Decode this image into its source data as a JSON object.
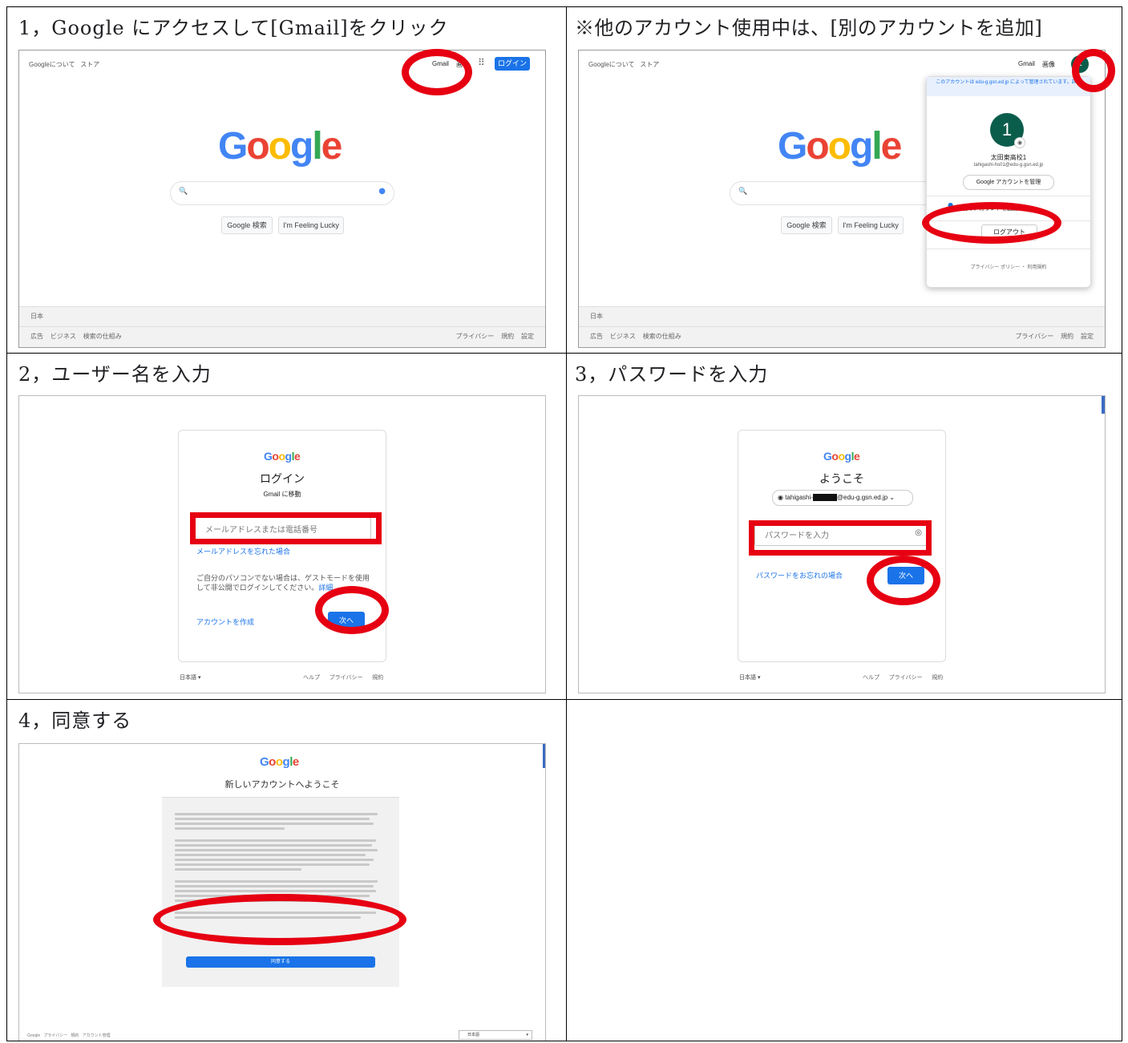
{
  "steps": {
    "s1": {
      "caption": "1，Google にアクセスして[Gmail]をクリック",
      "top_left": [
        "Googleについて",
        "ストア"
      ],
      "gmail": "Gmail",
      "images": "画",
      "login": "ログイン",
      "search_btn": "Google 検索",
      "lucky_btn": "I'm Feeling Lucky",
      "country": "日本",
      "footer_left": [
        "広告",
        "ビジネス",
        "検索の仕組み"
      ],
      "footer_right": [
        "プライバシー",
        "規約",
        "設定"
      ]
    },
    "s1b": {
      "caption": "※他のアカウント使用中は、[別のアカウントを追加]",
      "top_left": [
        "Googleについて",
        "ストア"
      ],
      "gmail": "Gmail",
      "images": "画像",
      "avatar_letter": "1",
      "managed_notice": "このアカウントは edu-g.gsn.ed.jp によって管理されています。詳細",
      "account_name": "太田東高校1",
      "account_email": "tahigashi-hs01@edu-g.gsn.ed.jp",
      "manage_btn": "Google アカウントを管理",
      "add_account": "別のアカウントを追加",
      "logout": "ログアウト",
      "policy": "プライバシー ポリシー ・ 利用規約",
      "search_btn": "Google 検索",
      "lucky_btn": "I'm Feeling Lucky",
      "country": "日本",
      "footer_left": [
        "広告",
        "ビジネス",
        "検索の仕組み"
      ],
      "footer_right": [
        "プライバシー",
        "規約",
        "設定"
      ]
    },
    "s2": {
      "caption": "2，ユーザー名を入力",
      "logo": "Google",
      "title": "ログイン",
      "subtitle": "Gmail に移動",
      "email_placeholder": "メールアドレスまたは電話番号",
      "forgot": "メールアドレスを忘れた場合",
      "guest_note": "ご自分のパソコンでない場合は、ゲストモードを使用して非公開でログインしてください。",
      "guest_link": "詳細",
      "create": "アカウントを作成",
      "next": "次へ",
      "lang": "日本語 ▾",
      "footer_links": [
        "ヘルプ",
        "プライバシー",
        "規約"
      ]
    },
    "s3": {
      "caption": "3，パスワードを入力",
      "logo": "Google",
      "title": "ようこそ",
      "account_pre": "tahigashi-",
      "account_post": "@edu-g.gsn.ed.jp",
      "password_placeholder": "パスワードを入力",
      "forgot": "パスワードをお忘れの場合",
      "next": "次へ",
      "lang": "日本語 ▾",
      "footer_links": [
        "ヘルプ",
        "プライバシー",
        "規約"
      ]
    },
    "s4": {
      "caption": "4，同意する",
      "logo": "Google",
      "title": "新しいアカウントへようこそ",
      "agree": "同意する",
      "footer_left": [
        "Google",
        "プライバシー",
        "規約",
        "アカウント管理"
      ],
      "lang": "日本語"
    }
  },
  "colors": {
    "annotation_red": "#e60012",
    "google_blue": "#1a73e8",
    "avatar_green": "#0b5d4b"
  },
  "icons": [
    "search-icon",
    "mic-icon",
    "apps-grid-icon",
    "add-person-icon",
    "eye-icon",
    "camera-icon"
  ]
}
